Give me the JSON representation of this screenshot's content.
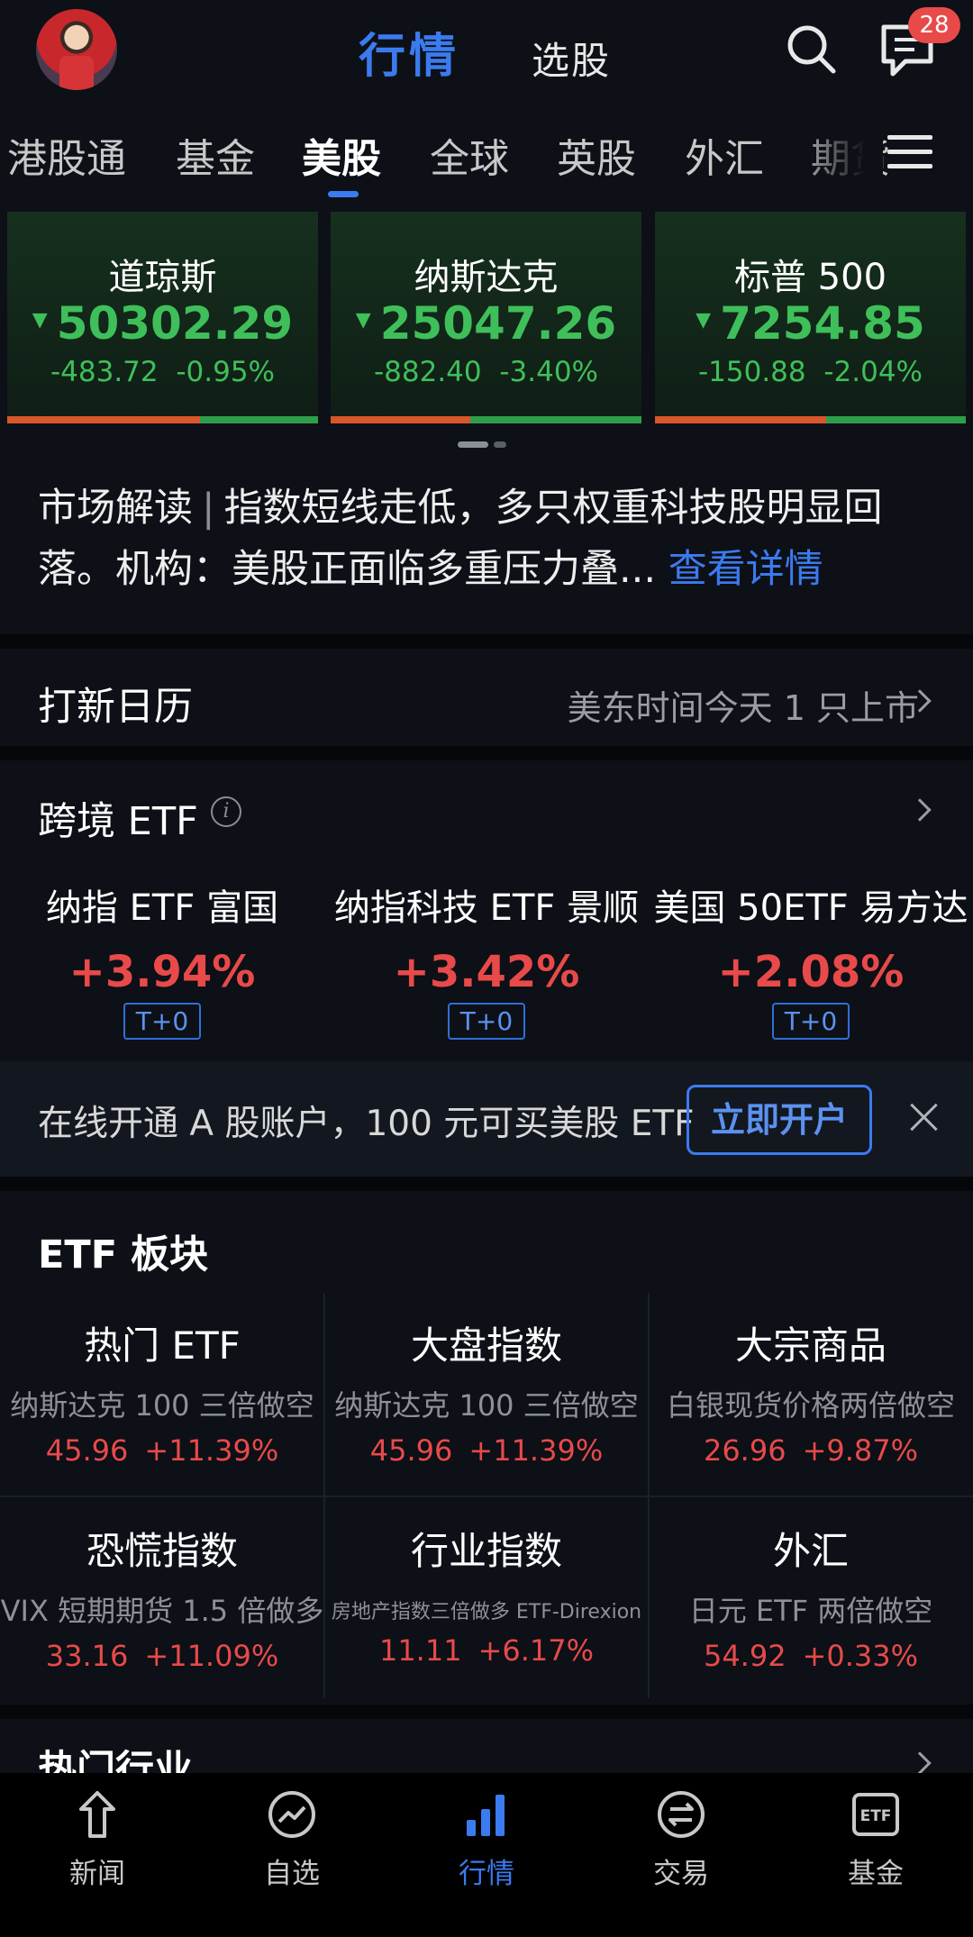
{
  "header": {
    "tab_quotes": "行情",
    "tab_screener": "选股",
    "message_count": "28"
  },
  "market_tabs": [
    "港股通",
    "基金",
    "美股",
    "全球",
    "英股",
    "外汇",
    "期货"
  ],
  "active_market_tab": "美股",
  "indices": [
    {
      "name": "道琼斯",
      "value": "50302.29",
      "change": "-483.72",
      "pct": "-0.95%"
    },
    {
      "name": "纳斯达克",
      "value": "25047.26",
      "change": "-882.40",
      "pct": "-3.40%"
    },
    {
      "name": "标普 500",
      "value": "7254.85",
      "change": "-150.88",
      "pct": "-2.04%"
    }
  ],
  "commentary": {
    "label": "市场解读",
    "separator": "|",
    "text": "指数短线走低，多只权重科技股明显回落。机构：美股正面临多重压力叠...",
    "link": "查看详情"
  },
  "ipo": {
    "title": "打新日历",
    "info": "美东时间今天 1 只上市"
  },
  "cross_border_etf": {
    "title": "跨境 ETF",
    "info_icon": "i",
    "items": [
      {
        "name": "纳指 ETF 富国",
        "pct": "+3.94%",
        "tag": "T+0"
      },
      {
        "name": "纳指科技 ETF 景顺",
        "pct": "+3.42%",
        "tag": "T+0"
      },
      {
        "name": "美国 50ETF 易方达",
        "pct": "+2.08%",
        "tag": "T+0"
      }
    ]
  },
  "promo": {
    "text": "在线开通 A 股账户，100 元可买美股 ETF",
    "button": "立即开户"
  },
  "etf_sectors": {
    "title": "ETF 板块",
    "cells": [
      {
        "name": "热门 ETF",
        "sub": "纳斯达克 100 三倍做空",
        "price": "45.96",
        "pct": "+11.39%"
      },
      {
        "name": "大盘指数",
        "sub": "纳斯达克 100 三倍做空",
        "price": "45.96",
        "pct": "+11.39%"
      },
      {
        "name": "大宗商品",
        "sub": "白银现货价格两倍做空",
        "price": "26.96",
        "pct": "+9.87%"
      },
      {
        "name": "恐慌指数",
        "sub": "VIX 短期期货 1.5 倍做多",
        "price": "33.16",
        "pct": "+11.09%"
      },
      {
        "name": "行业指数",
        "sub": "房地产指数三倍做多 ETF-Direxion",
        "price": "11.11",
        "pct": "+6.17%"
      },
      {
        "name": "外汇",
        "sub": "日元 ETF 两倍做空",
        "price": "54.92",
        "pct": "+0.33%"
      }
    ]
  },
  "hot_industry": {
    "title": "热门行业"
  },
  "bottom_nav": [
    {
      "label": "新闻",
      "icon": "news-icon"
    },
    {
      "label": "自选",
      "icon": "watchlist-icon"
    },
    {
      "label": "行情",
      "icon": "market-chart-icon"
    },
    {
      "label": "交易",
      "icon": "trade-exchange-icon"
    },
    {
      "label": "基金",
      "icon": "etf-fund-icon"
    }
  ],
  "active_nav": "行情",
  "colors": {
    "accent": "#3b7bf0",
    "up": "#e84a4a",
    "down": "#3fbf5a",
    "background": "#0d1016"
  }
}
